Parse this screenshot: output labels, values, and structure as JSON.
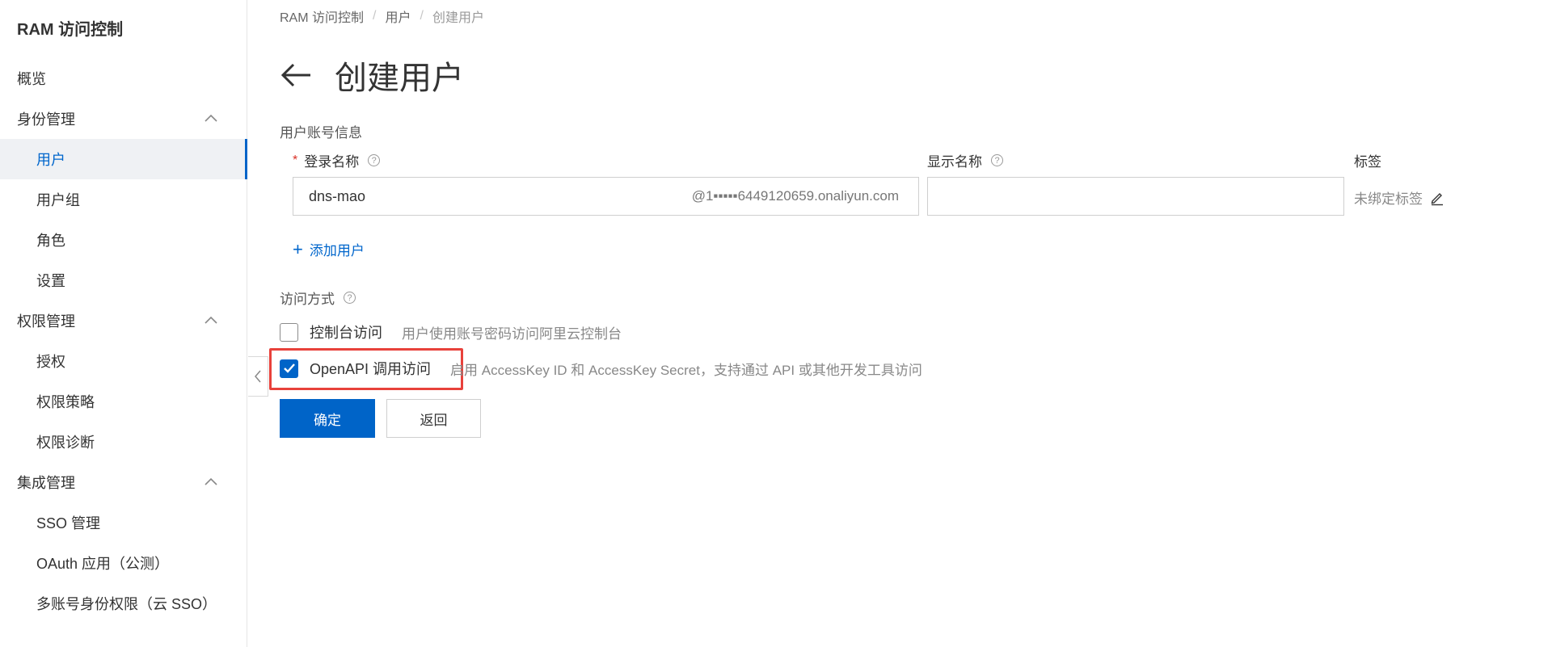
{
  "sidebar": {
    "title": "RAM 访问控制",
    "items": [
      {
        "label": "概览"
      },
      {
        "label": "身份管理"
      },
      {
        "label": "用户"
      },
      {
        "label": "用户组"
      },
      {
        "label": "角色"
      },
      {
        "label": "设置"
      },
      {
        "label": "权限管理"
      },
      {
        "label": "授权"
      },
      {
        "label": "权限策略"
      },
      {
        "label": "权限诊断"
      },
      {
        "label": "集成管理"
      },
      {
        "label": "SSO 管理"
      },
      {
        "label": "OAuth 应用（公测）"
      },
      {
        "label": "多账号身份权限（云 SSO）"
      }
    ]
  },
  "breadcrumb": [
    "RAM 访问控制",
    "用户",
    "创建用户"
  ],
  "page_title": "创建用户",
  "form": {
    "section_account": "用户账号信息",
    "login_name_label": "登录名称",
    "login_name_value": "dns-mao",
    "login_domain": "@1▪▪▪▪▪6449120659.onaliyun.com",
    "display_name_label": "显示名称",
    "display_name_value": "",
    "tags_label": "标签",
    "tags_value": "未绑定标签",
    "add_user": "添加用户",
    "section_access": "访问方式",
    "console_access_label": "控制台访问",
    "console_access_desc": "用户使用账号密码访问阿里云控制台",
    "openapi_access_label": "OpenAPI 调用访问",
    "openapi_access_desc": "启用 AccessKey ID 和 AccessKey Secret，支持通过 API 或其他开发工具访问",
    "console_checked": false,
    "openapi_checked": true
  },
  "buttons": {
    "confirm": "确定",
    "back": "返回"
  },
  "colors": {
    "primary": "#0064c8",
    "highlight": "#e8413b",
    "active_bg": "#eff1f4"
  }
}
